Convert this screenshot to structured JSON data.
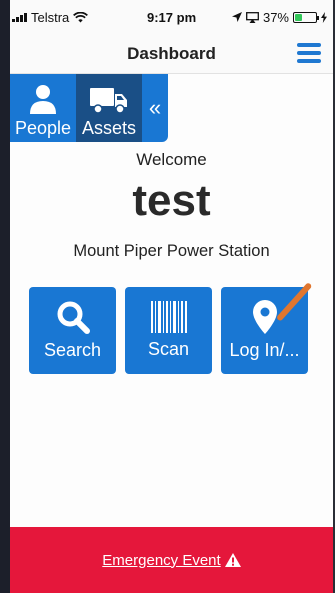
{
  "status_bar": {
    "carrier": "Telstra",
    "time": "9:17 pm",
    "battery_percent": "37%",
    "battery_level": 0.37
  },
  "nav": {
    "title": "Dashboard"
  },
  "side_tabs": {
    "items": [
      {
        "label": "People",
        "icon": "person-icon",
        "active": false
      },
      {
        "label": "Assets",
        "icon": "truck-icon",
        "active": true
      }
    ],
    "collapse_glyph": "«"
  },
  "main": {
    "welcome": "Welcome",
    "username": "test",
    "site": "Mount Piper Power Station"
  },
  "actions": [
    {
      "label": "Search",
      "icon": "search-icon"
    },
    {
      "label": "Scan",
      "icon": "barcode-icon"
    },
    {
      "label": "Log In/...",
      "icon": "location-pin-icon"
    }
  ],
  "emergency": {
    "label": "Emergency Event",
    "icon": "warning-icon"
  },
  "colors": {
    "primary": "#1977d3",
    "active_tab": "#1a4f86",
    "emergency": "#e5173b"
  }
}
